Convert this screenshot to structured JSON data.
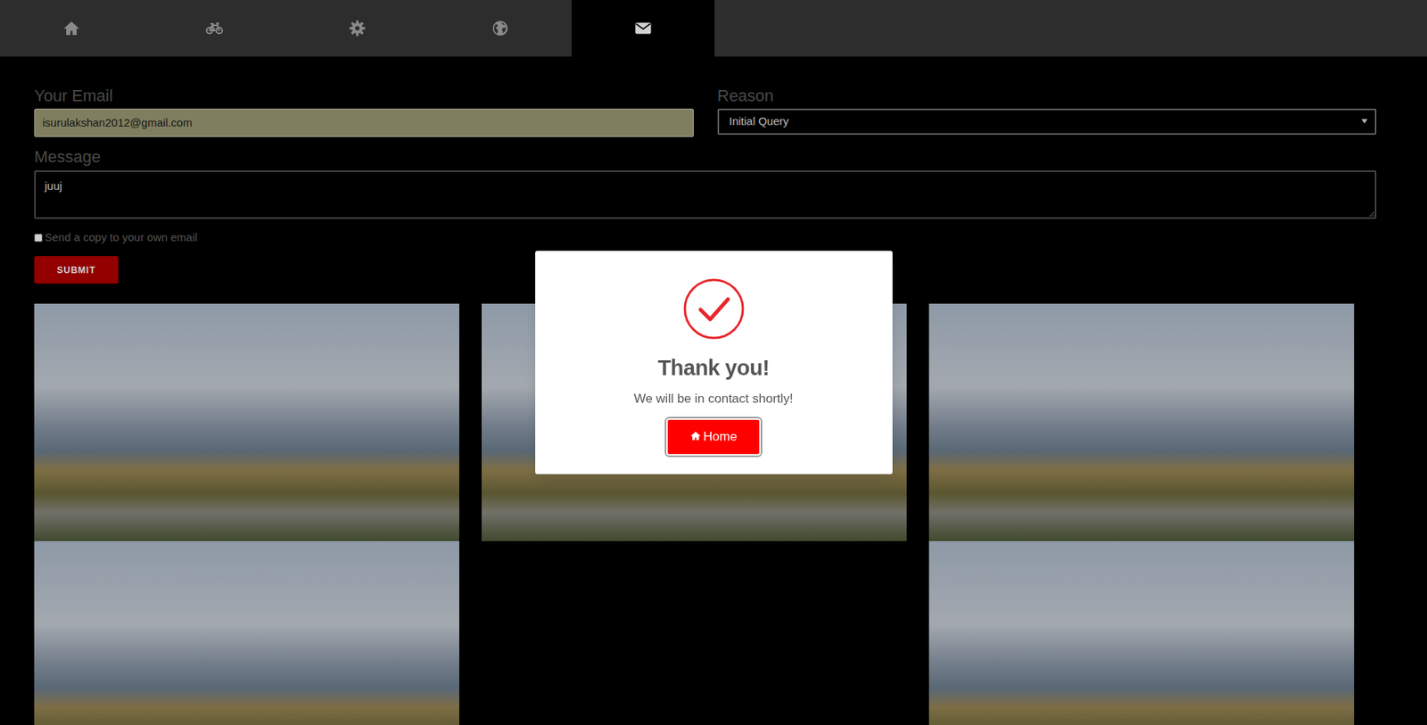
{
  "tabs": [
    {
      "selected": false
    },
    {
      "selected": false
    },
    {
      "selected": false
    },
    {
      "selected": false
    },
    {
      "selected": true
    }
  ],
  "form": {
    "email": {
      "label": "Your Email",
      "value": "isurulakshan2012@gmail.com"
    },
    "reason": {
      "label": "Reason",
      "value": "Initial Query"
    },
    "message": {
      "label": "Message",
      "value": "juuj"
    },
    "copy": {
      "label": "Send a copy to your own email",
      "checked": false
    },
    "submit": "SUBMIT"
  },
  "gallery": [
    {
      "kind": "photo"
    },
    {
      "kind": "photo"
    },
    {
      "kind": "photo"
    },
    {
      "kind": "photo"
    },
    {
      "kind": "empty"
    },
    {
      "kind": "photo"
    }
  ],
  "dialog": {
    "title": "Thank you!",
    "text": "We will be in contact shortly!",
    "button": "Home"
  }
}
